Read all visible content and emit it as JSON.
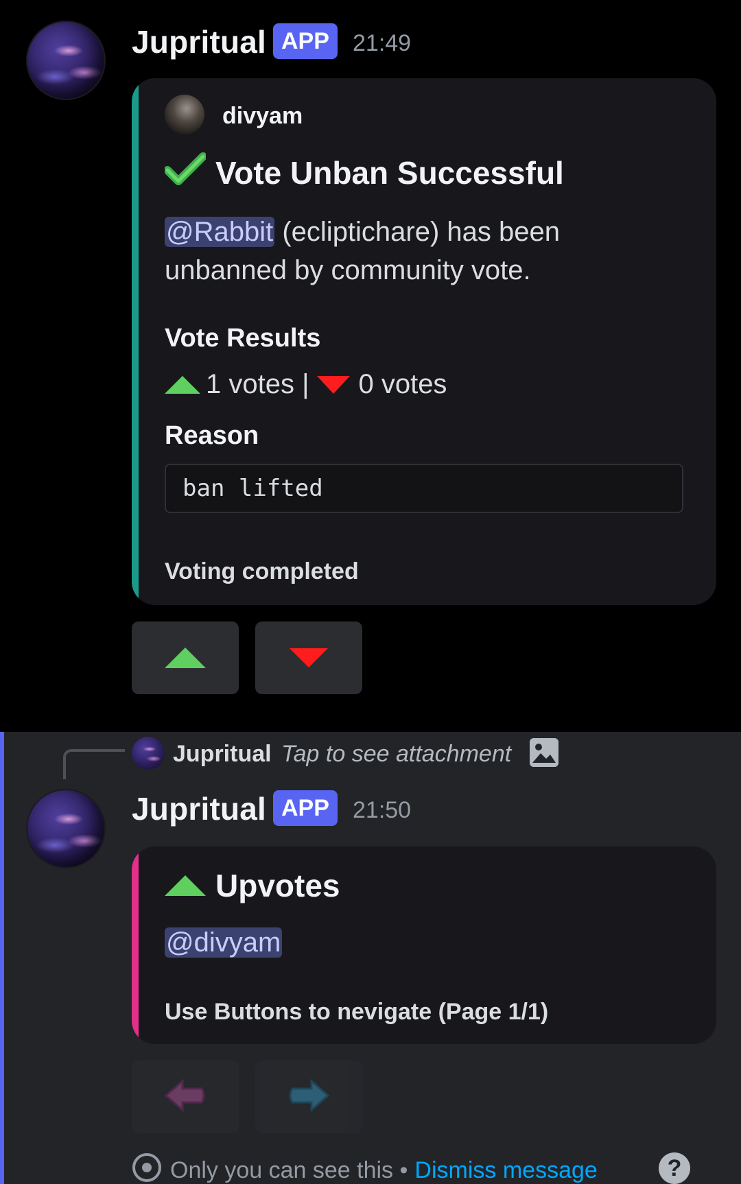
{
  "message1": {
    "username": "Jupritual",
    "badge": "APP",
    "time": "21:49",
    "embed": {
      "accent_color": "#1a9a8a",
      "author": "divyam",
      "title": "Vote Unban Successful",
      "mention": "@Rabbit",
      "description_rest_line1": " (ecliptichare) has been",
      "description_line2": "unbanned by community vote.",
      "field1_name": "Vote Results",
      "upvotes_text": "1 votes |",
      "downvotes_text": "0 votes",
      "field2_name": "Reason",
      "reason": "ban lifted",
      "footer": "Voting completed"
    },
    "buttons": [
      {
        "icon": "up-triangle-icon"
      },
      {
        "icon": "down-triangle-icon"
      }
    ]
  },
  "message2": {
    "reply": {
      "username": "Jupritual",
      "text": "Tap to see attachment",
      "icon": "image-icon"
    },
    "username": "Jupritual",
    "badge": "APP",
    "time": "21:50",
    "embed": {
      "accent_color": "#e0308a",
      "title": "Upvotes",
      "mention": "@divyam",
      "footer": "Use Buttons to nevigate (Page 1/1)"
    },
    "buttons": [
      {
        "icon": "left-arrow-icon",
        "disabled": true
      },
      {
        "icon": "right-arrow-icon",
        "disabled": true
      }
    ],
    "notice": {
      "text": "Only you can see this •",
      "link": "Dismiss message",
      "help": "?"
    }
  },
  "colors": {
    "blurple": "#5865f2",
    "upvote_green": "#5fcf60",
    "downvote_red": "#ff1c1c",
    "link_blue": "#00a8fc"
  }
}
